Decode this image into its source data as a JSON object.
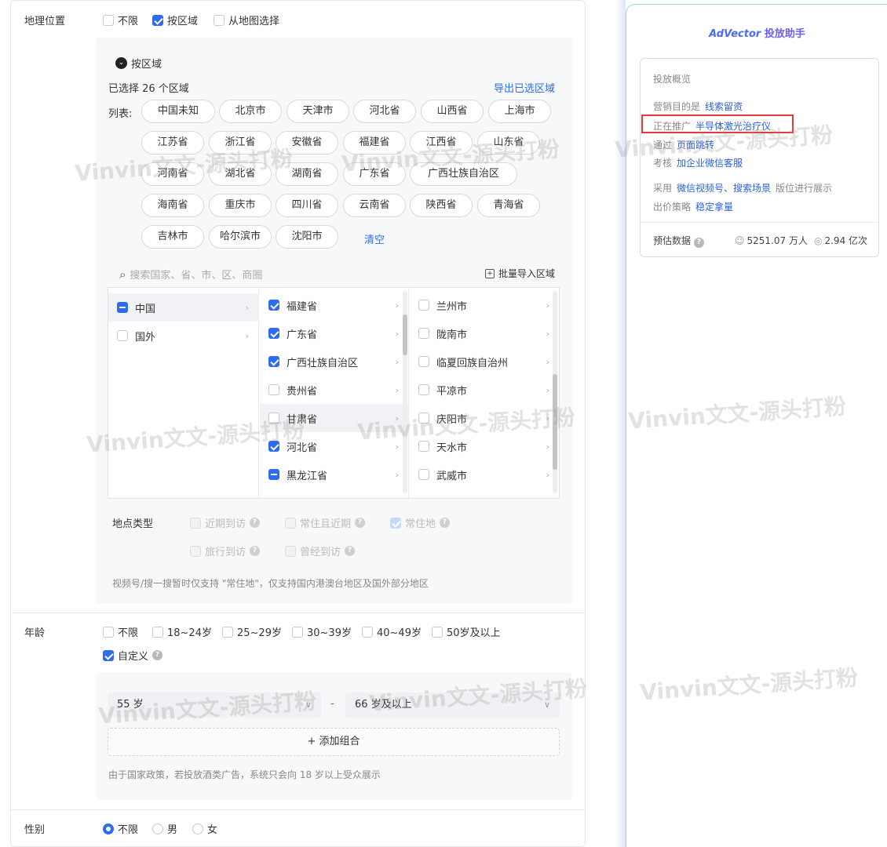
{
  "geo": {
    "label": "地理位置",
    "options": [
      "不限",
      "按区域",
      "从地图选择"
    ],
    "section_title": "按区域",
    "selected_count": "已选择 26 个区域",
    "export_link": "导出已选区域",
    "list_label": "列表:",
    "chips": [
      [
        "中国未知",
        "北京市",
        "天津市",
        "河北省",
        "山西省",
        "上海市"
      ],
      [
        "江苏省",
        "浙江省",
        "安徽省",
        "福建省",
        "江西省",
        "山东省"
      ],
      [
        "河南省",
        "湖北省",
        "湖南省",
        "广东省",
        "广西壮族自治区"
      ],
      [
        "海南省",
        "重庆市",
        "四川省",
        "云南省",
        "陕西省",
        "青海省"
      ],
      [
        "吉林市",
        "哈尔滨市",
        "沈阳市"
      ]
    ],
    "clear_link": "清空",
    "search_placeholder": "搜索国家、省、市、区、商圈",
    "bulk_import": "批量导入区域",
    "col1": [
      "中国",
      "国外"
    ],
    "col2": [
      "福建省",
      "广东省",
      "广西壮族自治区",
      "贵州省",
      "甘肃省",
      "河北省",
      "黑龙江省"
    ],
    "col3": [
      "兰州市",
      "陇南市",
      "临夏回族自治州",
      "平凉市",
      "庆阳市",
      "天水市",
      "武威市"
    ],
    "place_type_label": "地点类型",
    "place_types": [
      "近期到访",
      "常住且近期",
      "常住地",
      "旅行到访",
      "曾经到访"
    ],
    "place_note": "视频号/搜一搜暂时仅支持 \"常住地\"，仅支持国内港澳台地区及国外部分地区"
  },
  "age": {
    "label": "年龄",
    "options": [
      "不限",
      "18~24岁",
      "25~29岁",
      "30~39岁",
      "40~49岁",
      "50岁及以上"
    ],
    "custom": "自定义",
    "from": "55 岁",
    "dash": "-",
    "to": "66 岁及以上",
    "add_combo": "+ 添加组合",
    "note": "由于国家政策，若投放酒类广告，系统只会向 18 岁以上受众展示"
  },
  "gender": {
    "label": "性别",
    "options": [
      "不限",
      "男",
      "女"
    ]
  },
  "assistant": {
    "brand": "AdVector",
    "title_suffix": " 投放助手",
    "overview_title": "投放概览",
    "goal_label": "营销目的是",
    "goal_value": "线索留资",
    "promo_label": "正在推广",
    "promo_value": "半导体激光治疗仪",
    "via_label": "通过",
    "via_value": "页面跳转",
    "assess_label": "考核",
    "assess_value": "加企业微信客服",
    "use_label": "采用",
    "use_value": "微信视频号、搜索场景",
    "use_suffix": "版位进行展示",
    "bid_label": "出价策略",
    "bid_value": "稳定拿量",
    "estimate_label": "预估数据",
    "reach": "5251.07 万人",
    "impressions": "2.94 亿次"
  },
  "watermark": "Vinvin文文-源头打粉"
}
